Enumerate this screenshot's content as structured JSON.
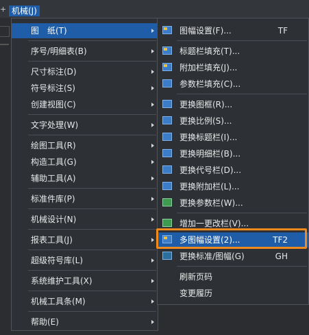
{
  "menubar": {
    "edge_glyph": "+",
    "active_menu": "机械(J)"
  },
  "main_menu": {
    "items": [
      {
        "label": "图　纸(T)"
      },
      {
        "label": "序号/明细表(B)"
      },
      {
        "label": "尺寸标注(D)"
      },
      {
        "label": "符号标注(S)"
      },
      {
        "label": "创建视图(C)"
      },
      {
        "label": "文字处理(W)"
      },
      {
        "label": "绘图工具(R)"
      },
      {
        "label": "构造工具(G)"
      },
      {
        "label": "辅助工具(A)"
      },
      {
        "label": "标准件库(P)"
      },
      {
        "label": "机械设计(N)"
      },
      {
        "label": "报表工具(J)"
      },
      {
        "label": "超级符号库(L)"
      },
      {
        "label": "系统维护工具(X)"
      },
      {
        "label": "机械工具条(M)"
      },
      {
        "label": "帮助(E)"
      }
    ]
  },
  "sub_menu": {
    "items": [
      {
        "label": "图幅设置(F)...",
        "shortcut": "TF",
        "icon": "sheet-settings-icon"
      },
      {
        "label": "标题栏填充(T)...",
        "shortcut": "",
        "icon": "titleblock-fill-icon"
      },
      {
        "label": "附加栏填充(J)...",
        "shortcut": "",
        "icon": "extra-block-fill-icon"
      },
      {
        "label": "参数栏填充(C)...",
        "shortcut": "",
        "icon": "param-block-fill-icon"
      },
      {
        "label": "更换图框(R)...",
        "shortcut": "",
        "icon": "replace-frame-icon"
      },
      {
        "label": "更换比例(S)...",
        "shortcut": "",
        "icon": "replace-scale-icon"
      },
      {
        "label": "更换标题栏(I)...",
        "shortcut": "",
        "icon": "replace-titleblock-icon"
      },
      {
        "label": "更换明细栏(B)...",
        "shortcut": "",
        "icon": "replace-bom-icon"
      },
      {
        "label": "更换代号栏(D)...",
        "shortcut": "",
        "icon": "replace-code-block-icon"
      },
      {
        "label": "更换附加栏(L)...",
        "shortcut": "",
        "icon": "replace-extra-block-icon"
      },
      {
        "label": "更换参数栏(W)...",
        "shortcut": "",
        "icon": "replace-param-block-icon"
      },
      {
        "label": "增加一更改栏(V)...",
        "shortcut": "",
        "icon": "add-change-block-icon"
      },
      {
        "label": "多图幅设置(2)...",
        "shortcut": "TF2",
        "icon": "multi-sheet-settings-icon"
      },
      {
        "label": "更换标准/图幅(G)",
        "shortcut": "GH",
        "icon": "replace-standard-icon"
      },
      {
        "label": "刷新页码",
        "shortcut": "",
        "icon": ""
      },
      {
        "label": "变更履历",
        "shortcut": "",
        "icon": ""
      }
    ]
  }
}
